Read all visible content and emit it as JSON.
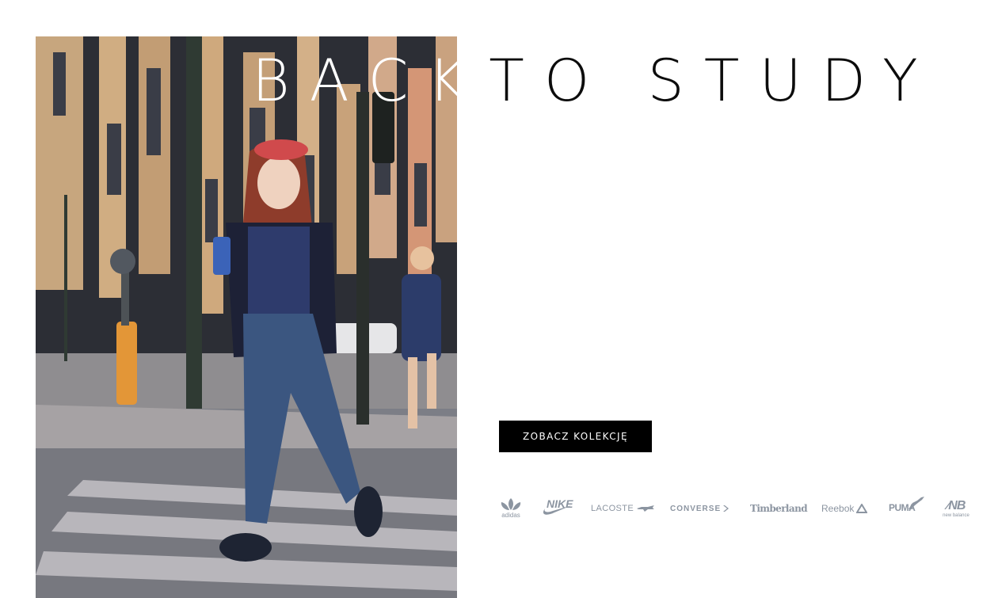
{
  "hero": {
    "headline_word_1": "BACK",
    "headline_word_2": "TO STUDY"
  },
  "cta": {
    "label": "ZOBACZ KOLEKCJĘ"
  },
  "brands": [
    {
      "name": "adidas",
      "icon": "adidas-trefoil-icon"
    },
    {
      "name": "NIKE",
      "icon": "nike-swoosh-icon"
    },
    {
      "name": "LACOSTE",
      "icon": "crocodile-icon"
    },
    {
      "name": "CONVERSE",
      "icon": "converse-chevron-icon"
    },
    {
      "name": "Timberland",
      "icon": "timberland-tree-icon"
    },
    {
      "name": "Reebok",
      "icon": "reebok-delta-icon"
    },
    {
      "name": "PUMA",
      "icon": "puma-cat-icon"
    },
    {
      "name": "new balance",
      "icon": "nb-monogram-icon"
    }
  ],
  "colors": {
    "background": "#ffffff",
    "headline": "#0c0c0c",
    "button": "#000000",
    "button_text": "#ffffff",
    "brand_logos": "#8c95a1"
  }
}
